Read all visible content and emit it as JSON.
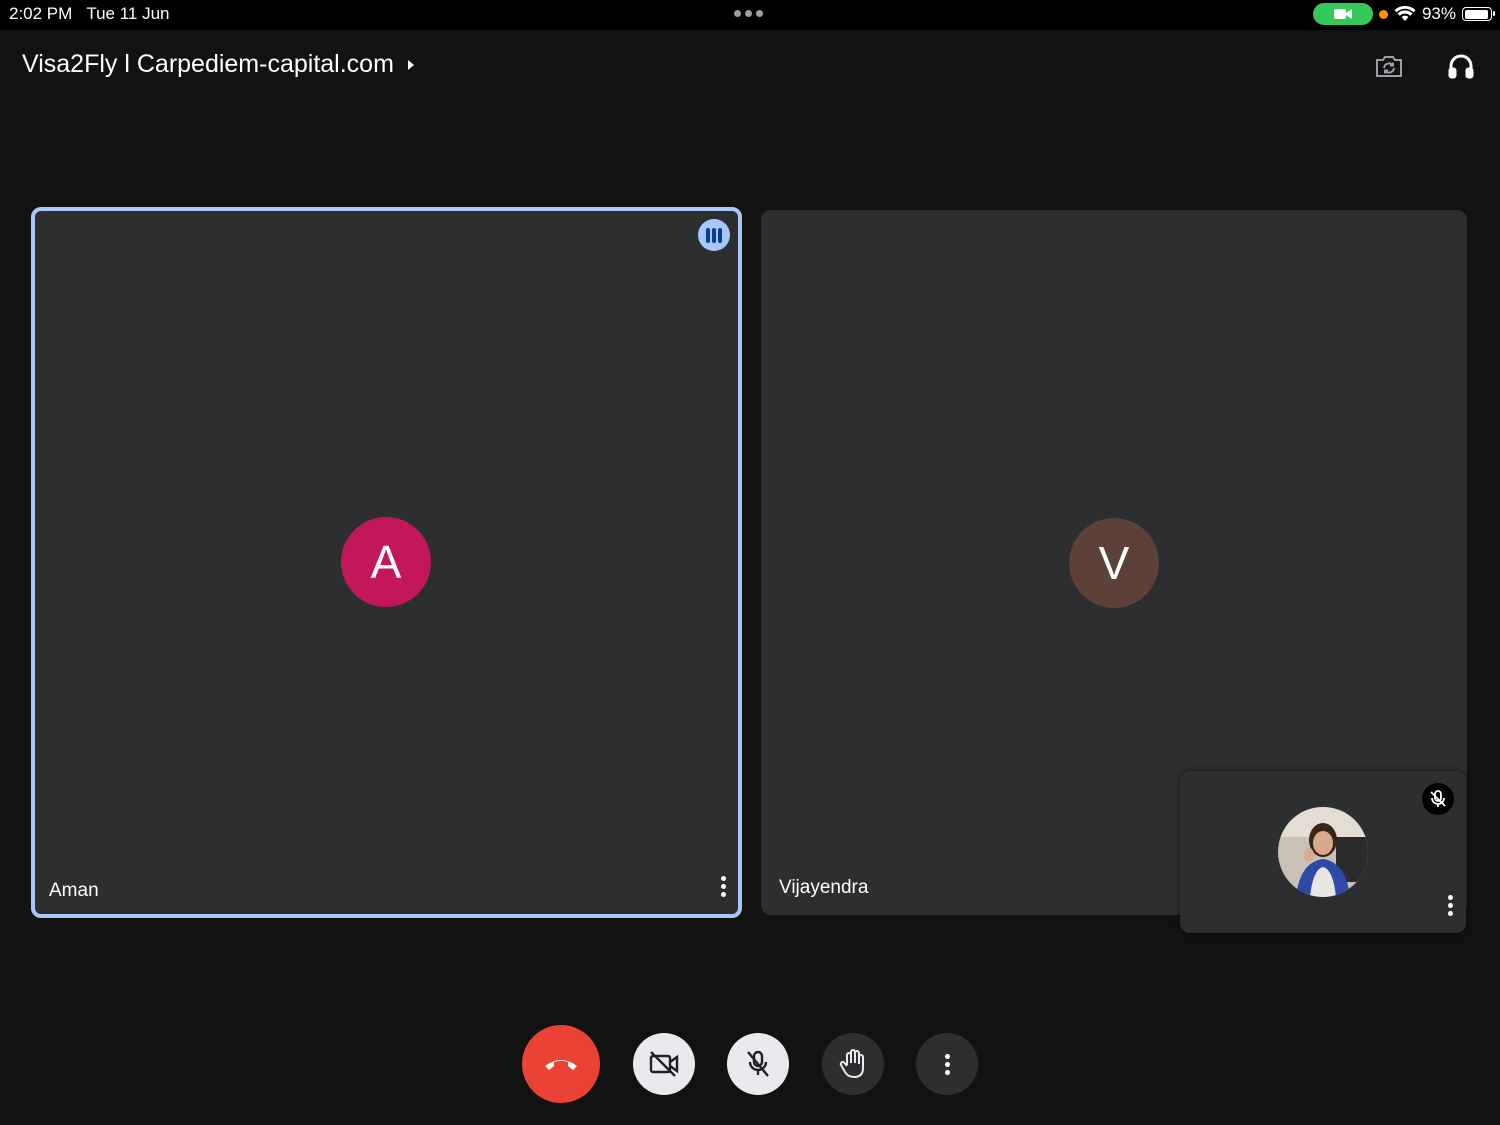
{
  "status_bar": {
    "time": "2:02 PM",
    "date": "Tue 11 Jun",
    "battery_percent": "93%",
    "battery_level": 0.93,
    "camera_active_color": "#34c759",
    "privacy_dot_color": "#ff9500"
  },
  "header": {
    "meeting_title": "Visa2Fly l Carpediem-capital.com",
    "icons": [
      "switch-camera-icon",
      "headphones-icon"
    ]
  },
  "participants": [
    {
      "name": "Aman",
      "initial": "A",
      "avatar_color": "#c2185b",
      "speaking": true
    },
    {
      "name": "Vijayendra",
      "initial": "V",
      "avatar_color": "#5d4037",
      "speaking": false
    }
  ],
  "self_view": {
    "muted": true,
    "icons": [
      "mic-off-icon",
      "more-vert-icon"
    ]
  },
  "controls": [
    {
      "name": "end-call",
      "icon": "call-end-icon",
      "color": "#ea4335"
    },
    {
      "name": "camera",
      "icon": "videocam-off-icon",
      "state": "off"
    },
    {
      "name": "microphone",
      "icon": "mic-off-icon",
      "state": "off"
    },
    {
      "name": "raise-hand",
      "icon": "hand-icon"
    },
    {
      "name": "more-options",
      "icon": "more-vert-icon"
    }
  ],
  "colors": {
    "background": "#121212",
    "tile": "#2d2e30",
    "active_outline": "#a8c7fa"
  }
}
